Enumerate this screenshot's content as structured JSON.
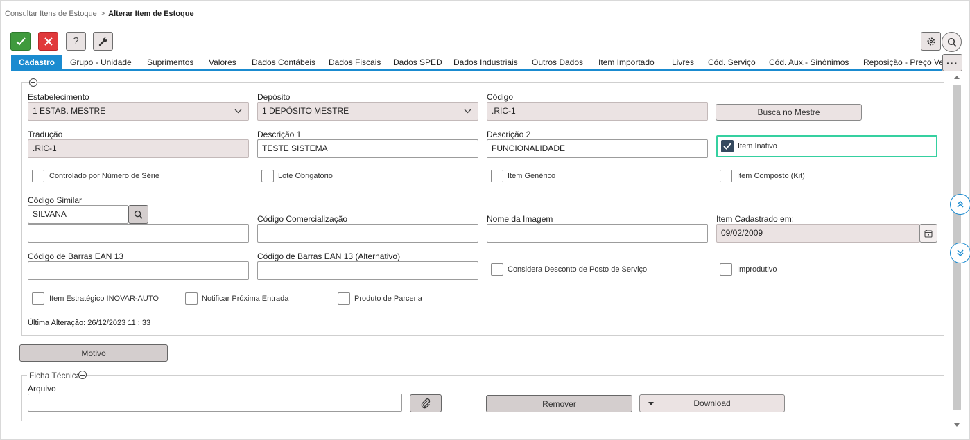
{
  "breadcrumb": {
    "parent": "Consultar Itens de Estoque",
    "separator": ">",
    "current": "Alterar Item de Estoque"
  },
  "toolbar": {
    "ok_icon": "check-icon",
    "cancel_icon": "close-icon",
    "help_label": "?",
    "tool_icon": "wrench-icon",
    "settings_icon": "gear-icon",
    "search_icon": "search-icon",
    "more_label": "···"
  },
  "tabs": [
    {
      "label": "Cadastro",
      "active": true
    },
    {
      "label": "Grupo - Unidade"
    },
    {
      "label": "Suprimentos"
    },
    {
      "label": "Valores"
    },
    {
      "label": "Dados Contábeis"
    },
    {
      "label": "Dados Fiscais"
    },
    {
      "label": "Dados SPED"
    },
    {
      "label": "Dados Industriais"
    },
    {
      "label": "Outros Dados"
    },
    {
      "label": "Item Importado"
    },
    {
      "label": "Livres"
    },
    {
      "label": "Cód. Serviço"
    },
    {
      "label": "Cód. Aux.- Sinônimos"
    },
    {
      "label": "Reposição - Preço Ven"
    }
  ],
  "form": {
    "estabelecimento": {
      "label": "Estabelecimento",
      "value": "1 ESTAB. MESTRE"
    },
    "deposito": {
      "label": "Depósito",
      "value": "1 DEPÓSITO MESTRE"
    },
    "codigo": {
      "label": "Código",
      "value": ".RIC-1"
    },
    "busca_mestre": "Busca no Mestre",
    "traducao": {
      "label": "Tradução",
      "value": ".RIC-1"
    },
    "descricao1": {
      "label": "Descrição 1",
      "value": "TESTE SISTEMA"
    },
    "descricao2": {
      "label": "Descrição 2",
      "value": "FUNCIONALIDADE"
    },
    "item_inativo": {
      "label": "Item Inativo",
      "checked": true
    },
    "controlado_serie": {
      "label": "Controlado por Número de Série",
      "checked": false
    },
    "lote_obrigatorio": {
      "label": "Lote Obrigatório",
      "checked": false
    },
    "item_generico": {
      "label": "Item Genérico",
      "checked": false
    },
    "item_composto": {
      "label": "Item Composto (Kit)",
      "checked": false
    },
    "codigo_similar": {
      "label": "Código Similar",
      "value": "SILVANA",
      "second_value": ""
    },
    "codigo_comercializacao": {
      "label": "Código Comercialização",
      "value": ""
    },
    "nome_imagem": {
      "label": "Nome da Imagem",
      "value": ""
    },
    "item_cadastrado": {
      "label": "Item Cadastrado em:",
      "value": "09/02/2009"
    },
    "ean13": {
      "label": "Código de Barras EAN 13",
      "value": ""
    },
    "ean13_alt": {
      "label": "Código de Barras EAN 13 (Alternativo)",
      "value": ""
    },
    "considera_desconto": {
      "label": "Considera Desconto de Posto de Serviço",
      "checked": false
    },
    "improdutivo": {
      "label": "Improdutivo",
      "checked": false
    },
    "item_estrategico": {
      "label": "Item Estratégico INOVAR-AUTO",
      "checked": false
    },
    "notificar_entrada": {
      "label": "Notificar Próxima Entrada",
      "checked": false
    },
    "produto_parceria": {
      "label": "Produto de Parceria",
      "checked": false
    },
    "ultima_alteracao": "Última Alteração: 26/12/2023 11 : 33"
  },
  "motivo_button": "Motivo",
  "ficha_tecnica": {
    "title": "Ficha Técnica",
    "arquivo_label": "Arquivo",
    "arquivo_value": "",
    "attach_icon": "paperclip-icon",
    "remover": "Remover",
    "download": "Download"
  },
  "colors": {
    "accent": "#1a8bd0",
    "ok": "#3f9a3d",
    "cancel": "#e0393b",
    "focus": "#35d0a0",
    "readonly": "#ebe3e3"
  }
}
